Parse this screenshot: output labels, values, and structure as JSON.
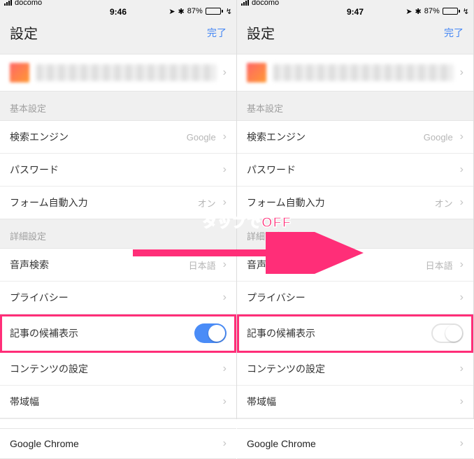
{
  "status": {
    "carrier": "docomo",
    "battery_pct": "87%",
    "nav_glyph": "➤",
    "bt_glyph": "✱",
    "charge_glyph": "↯"
  },
  "left": {
    "time": "9:46",
    "header": {
      "title": "設定",
      "done": "完了"
    },
    "section_basic": "基本設定",
    "rows_basic": {
      "search_engine": {
        "label": "検索エンジン",
        "value": "Google"
      },
      "passwords": {
        "label": "パスワード"
      },
      "autofill": {
        "label": "フォーム自動入力",
        "value": "オン"
      }
    },
    "section_adv": "詳細設定",
    "rows_adv": {
      "voice": {
        "label": "音声検索",
        "value": "日本語"
      },
      "privacy": {
        "label": "プライバシー"
      },
      "suggest": {
        "label": "記事の候補表示",
        "toggle": true
      },
      "content": {
        "label": "コンテンツの設定"
      },
      "bandwidth": {
        "label": "帯域幅"
      }
    },
    "about": {
      "label": "Google Chrome"
    }
  },
  "right": {
    "time": "9:47",
    "header": {
      "title": "設定",
      "done": "完了"
    },
    "section_basic": "基本設定",
    "rows_basic": {
      "search_engine": {
        "label": "検索エンジン",
        "value": "Google"
      },
      "passwords": {
        "label": "パスワード"
      },
      "autofill": {
        "label": "フォーム自動入力",
        "value": "オン"
      }
    },
    "section_adv": "詳細設定",
    "rows_adv": {
      "voice": {
        "label": "音声検索",
        "value": "日本語"
      },
      "privacy": {
        "label": "プライバシー"
      },
      "suggest": {
        "label": "記事の候補表示",
        "toggle": false
      },
      "content": {
        "label": "コンテンツの設定"
      },
      "bandwidth": {
        "label": "帯域幅"
      }
    },
    "about": {
      "label": "Google Chrome"
    }
  },
  "annotation": {
    "caption": "タップでOFF"
  }
}
